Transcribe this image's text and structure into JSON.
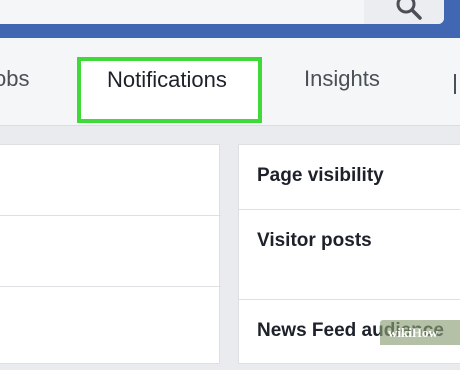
{
  "topbar": {
    "search_icon": "search-icon"
  },
  "tabs": {
    "jobs_partial": "obs",
    "notifications": "Notifications",
    "insights": "Insights"
  },
  "highlight_color": "#3fd93a",
  "settings": [
    {
      "label": "Page visibility"
    },
    {
      "label": "Visitor posts"
    },
    {
      "label": "News Feed audience"
    }
  ],
  "watermark": "wikiHow"
}
